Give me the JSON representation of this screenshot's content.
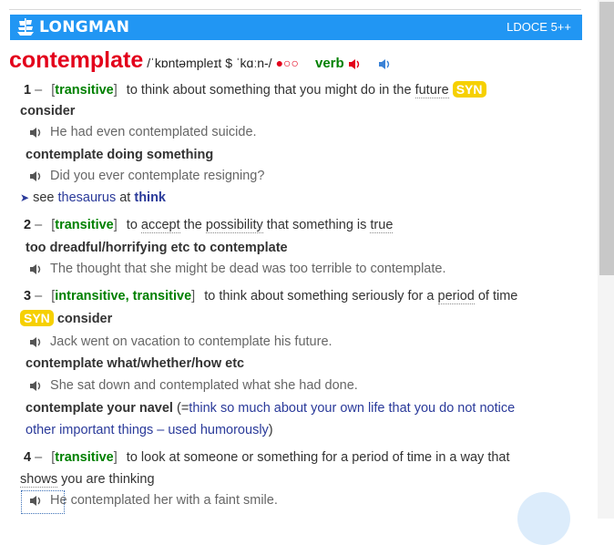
{
  "header": {
    "brand": "LONGMAN",
    "edition": "LDOCE 5++",
    "bg_color": "#2196f3"
  },
  "entry": {
    "headword": "contemplate",
    "pronunciation": "/ˈkɒntəmpleɪt $ ˈkɑːn-/",
    "frequency": "●○○",
    "pos": "verb",
    "speaker_uk_icon": "speaker-red-icon",
    "speaker_us_icon": "speaker-blue-icon",
    "senses": [
      {
        "number": "1",
        "dash": "–",
        "grammar_open": "[",
        "grammar": "transitive",
        "grammar_close": "]",
        "definition_pre": "to think about something that you might do in the ",
        "definition_link": "future",
        "syn_label": "SYN",
        "synonym": "consider",
        "example1": "He had even contemplated suicide.",
        "pattern": "contemplate doing something",
        "example2": "Did you ever contemplate resigning?",
        "see_prefix": "see",
        "see_link": "thesaurus",
        "see_at": "at",
        "see_target": "think"
      },
      {
        "number": "2",
        "dash": "–",
        "grammar_open": "[",
        "grammar": "transitive",
        "grammar_close": "]",
        "def_p1": "to ",
        "def_u1": "accept",
        "def_p2": " the ",
        "def_u2": "possibility",
        "def_p3": " that something is ",
        "def_u3": "true",
        "pattern": "too dreadful/horrifying etc to contemplate",
        "example": "The thought that she might be dead was too terrible to contemplate."
      },
      {
        "number": "3",
        "dash": "–",
        "grammar_open": "[",
        "grammar": "intransitive, transitive",
        "grammar_close": "]",
        "def_p1": "to think about something seriously for a ",
        "def_u1": "period",
        "def_p2": " of time",
        "syn_label": "SYN",
        "synonym": "consider",
        "example1": "Jack went on vacation to contemplate his future.",
        "pattern": "contemplate what/whether/how etc",
        "example2": "She sat down and contemplated what she had done.",
        "idiom": "contemplate your navel",
        "idiom_open": "(=",
        "idiom_gloss1": "think so much about your own life that you do not notice",
        "idiom_gloss2": "other important things – used humorously",
        "idiom_close": ")"
      },
      {
        "number": "4",
        "dash": "–",
        "grammar_open": "[",
        "grammar": "transitive",
        "grammar_close": "]",
        "definition": "to look at someone or something for a period of time in a way that",
        "def2_u": "shows",
        "def2_rest": " you are thinking",
        "example": "He contemplated her with a faint smile."
      }
    ]
  }
}
